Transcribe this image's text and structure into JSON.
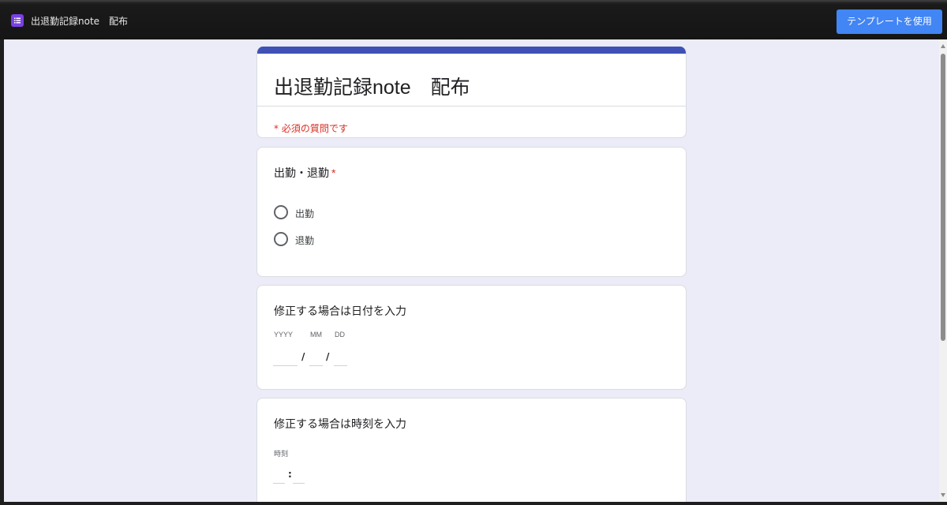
{
  "topbar": {
    "title": "出退勤記録note　配布",
    "app_icon": "forms-list-icon",
    "use_template_label": "テンプレートを使用"
  },
  "form": {
    "title": "出退勤記録note　配布",
    "required_note": "* 必須の質問です",
    "accent_color": "#3f51b5"
  },
  "questions": [
    {
      "title": "出勤・退勤",
      "required_mark": "*",
      "options": [
        {
          "label": "出勤"
        },
        {
          "label": "退勤"
        }
      ]
    },
    {
      "title": "修正する場合は日付を入力",
      "year_label": "YYYY",
      "month_label": "MM",
      "day_label": "DD",
      "separator": "/"
    },
    {
      "title": "修正する場合は時刻を入力",
      "time_label": "時刻",
      "separator": ":"
    }
  ]
}
